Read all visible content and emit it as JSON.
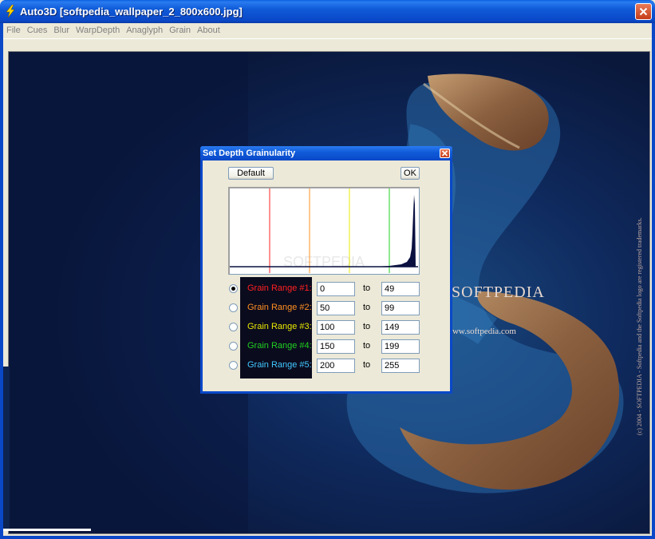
{
  "window": {
    "title": "Auto3D [softpedia_wallpaper_2_800x600.jpg]",
    "colors": {
      "titlebar": "#0a48c8",
      "menu_text": "#808080"
    }
  },
  "menu": [
    "File",
    "Cues",
    "Blur",
    "WarpDepth",
    "Anaglyph",
    "Grain",
    "About"
  ],
  "image": {
    "brand": "SOFTPEDIA",
    "url_text": "www.softpedia.com",
    "copyright": "(c) 2004 - SOFTPEDIA - Softpedia and the Softpedia logo are registered trademarks."
  },
  "dialog": {
    "title": "Set Depth Grainularity",
    "default_label": "Default",
    "ok_label": "OK",
    "histogram_watermark": "SOFTPEDIA",
    "histogram_markers": [
      {
        "value": 50,
        "color": "#ff2020"
      },
      {
        "value": 100,
        "color": "#ff9020"
      },
      {
        "value": 150,
        "color": "#e8e800"
      },
      {
        "value": 200,
        "color": "#20d020"
      }
    ],
    "ranges": [
      {
        "label": "Grain Range #1:",
        "from": "0",
        "to": "49",
        "color": "#ff2020",
        "selected": true
      },
      {
        "label": "Grain Range #2:",
        "from": "50",
        "to": "99",
        "color": "#ff9020",
        "selected": false
      },
      {
        "label": "Grain Range #3:",
        "from": "100",
        "to": "149",
        "color": "#e8e800",
        "selected": false
      },
      {
        "label": "Grain Range #4:",
        "from": "150",
        "to": "199",
        "color": "#20d020",
        "selected": false
      },
      {
        "label": "Grain Range #5:",
        "from": "200",
        "to": "255",
        "color": "#40c8ff",
        "selected": false
      }
    ],
    "to_label": "to"
  }
}
